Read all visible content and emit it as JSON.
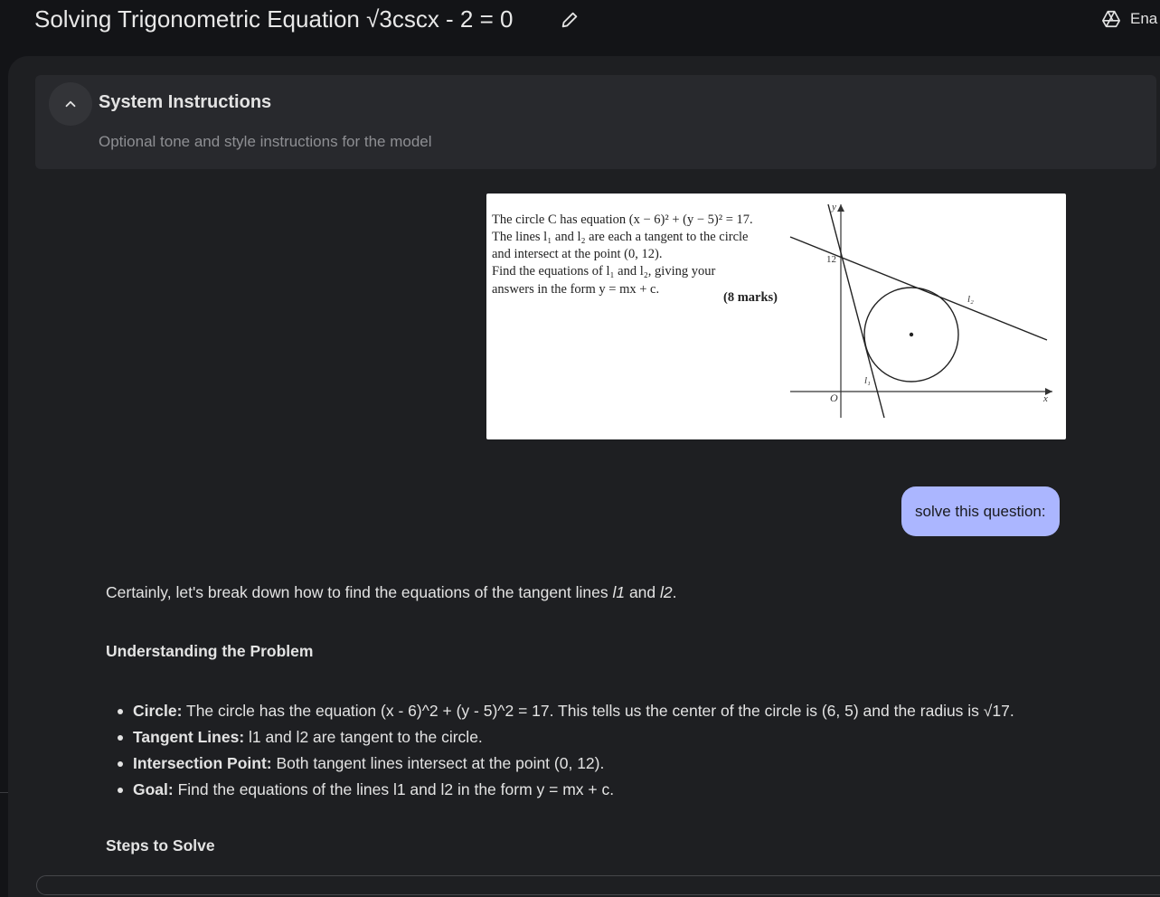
{
  "header": {
    "title": "Solving Trigonometric Equation √3cscx - 2 = 0",
    "enable_label": "Ena"
  },
  "system_instructions": {
    "title": "System Instructions",
    "placeholder": "Optional tone and style instructions for the model"
  },
  "question_image": {
    "lines": [
      "The circle C has equation (x − 6)² + (y − 5)² = 17.",
      "The lines l₁ and l₂ are each a tangent to the circle",
      "and intersect at the point (0, 12).",
      "Find the equations of l₁ and l₂, giving your",
      "answers in the form y = mx + c."
    ],
    "marks": "(8 marks)",
    "graph_labels": {
      "y_axis": "y",
      "x_axis": "x",
      "origin": "O",
      "y_intercept": "12",
      "line1": "l₁",
      "line2": "l₂"
    }
  },
  "user_message": "solve this question:",
  "response": {
    "intro_before": "Certainly, let's break down how to find the equations of the tangent lines ",
    "intro_l1": "l1",
    "intro_and": " and ",
    "intro_l2": "l2",
    "intro_end": ".",
    "heading1": "Understanding the Problem",
    "bullets": [
      {
        "label": "Circle:",
        "text": " The circle has the equation (x - 6)^2 + (y - 5)^2 = 17. This tells us the center of the circle is (6, 5) and the radius is √17."
      },
      {
        "label": "Tangent Lines:",
        "text": " l1 and l2 are tangent to the circle."
      },
      {
        "label": "Intersection Point:",
        "text": " Both tangent lines intersect at the point (0, 12)."
      },
      {
        "label": "Goal:",
        "text": " Find the equations of the lines l1 and l2 in the form y = mx + c."
      }
    ],
    "heading2": "Steps to Solve"
  },
  "colors": {
    "background": "#131417",
    "panel": "#1e1f22",
    "user_bubble": "#abb6ff"
  }
}
